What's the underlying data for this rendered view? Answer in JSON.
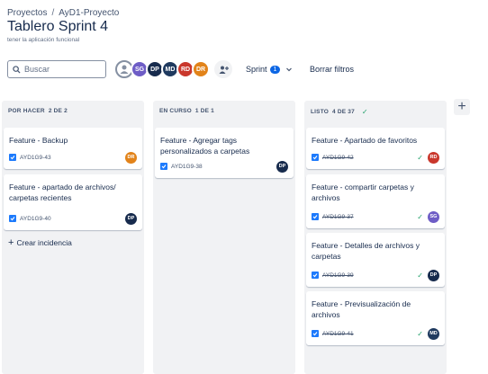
{
  "breadcrumb": {
    "root": "Proyectos",
    "separator": "/",
    "project": "AyD1-Proyecto"
  },
  "page": {
    "title": "Tablero Sprint 4",
    "subtitle": "tener la aplicación funcional"
  },
  "search": {
    "placeholder": "Buscar",
    "value": ""
  },
  "avatars": [
    {
      "initials": "",
      "color": "#ffffff",
      "icon": "user-icon"
    },
    {
      "initials": "SG",
      "color": "#6e5dc6"
    },
    {
      "initials": "DP",
      "color": "#172b4d"
    },
    {
      "initials": "MD",
      "color": "#1f3a5f"
    },
    {
      "initials": "RD",
      "color": "#c9372c"
    },
    {
      "initials": "DR",
      "color": "#e2831a"
    }
  ],
  "toolbar": {
    "sprint_label": "Sprint",
    "sprint_count": "1",
    "clear_filters": "Borrar filtros"
  },
  "columns": [
    {
      "title": "POR HACER",
      "count": "2 DE 2",
      "cards": [
        {
          "title": "Feature - Backup",
          "key": "AYD1G9-43",
          "assignee": "DR",
          "color": "#e2831a",
          "done": false
        },
        {
          "title": "Feature - apartado de archivos/ carpetas recientes",
          "key": "AYD1G9-40",
          "assignee": "DP",
          "color": "#172b4d",
          "done": false
        }
      ],
      "create_label": "Crear incidencia"
    },
    {
      "title": "EN CURSO",
      "count": "1 DE 1",
      "cards": [
        {
          "title": "Feature - Agregar tags personalizados a carpetas",
          "key": "AYD1G9-38",
          "assignee": "DP",
          "color": "#172b4d",
          "done": false
        }
      ]
    },
    {
      "title": "LISTO",
      "count": "4 DE 37",
      "cards": [
        {
          "title": "Feature - Apartado de favoritos",
          "key": "AYD1G9-42",
          "assignee": "RD",
          "color": "#c9372c",
          "done": true
        },
        {
          "title": "Feature - compartir carpetas y archivos",
          "key": "AYD1G9-37",
          "assignee": "SG",
          "color": "#6e5dc6",
          "done": true
        },
        {
          "title": "Feature - Detalles de archivos y carpetas",
          "key": "AYD1G9-39",
          "assignee": "DP",
          "color": "#172b4d",
          "done": true
        },
        {
          "title": "Feature - Previsualización de archivos",
          "key": "AYD1G9-41",
          "assignee": "MD",
          "color": "#1f3a5f",
          "done": true
        }
      ]
    }
  ],
  "add_column": {
    "label": "+"
  }
}
